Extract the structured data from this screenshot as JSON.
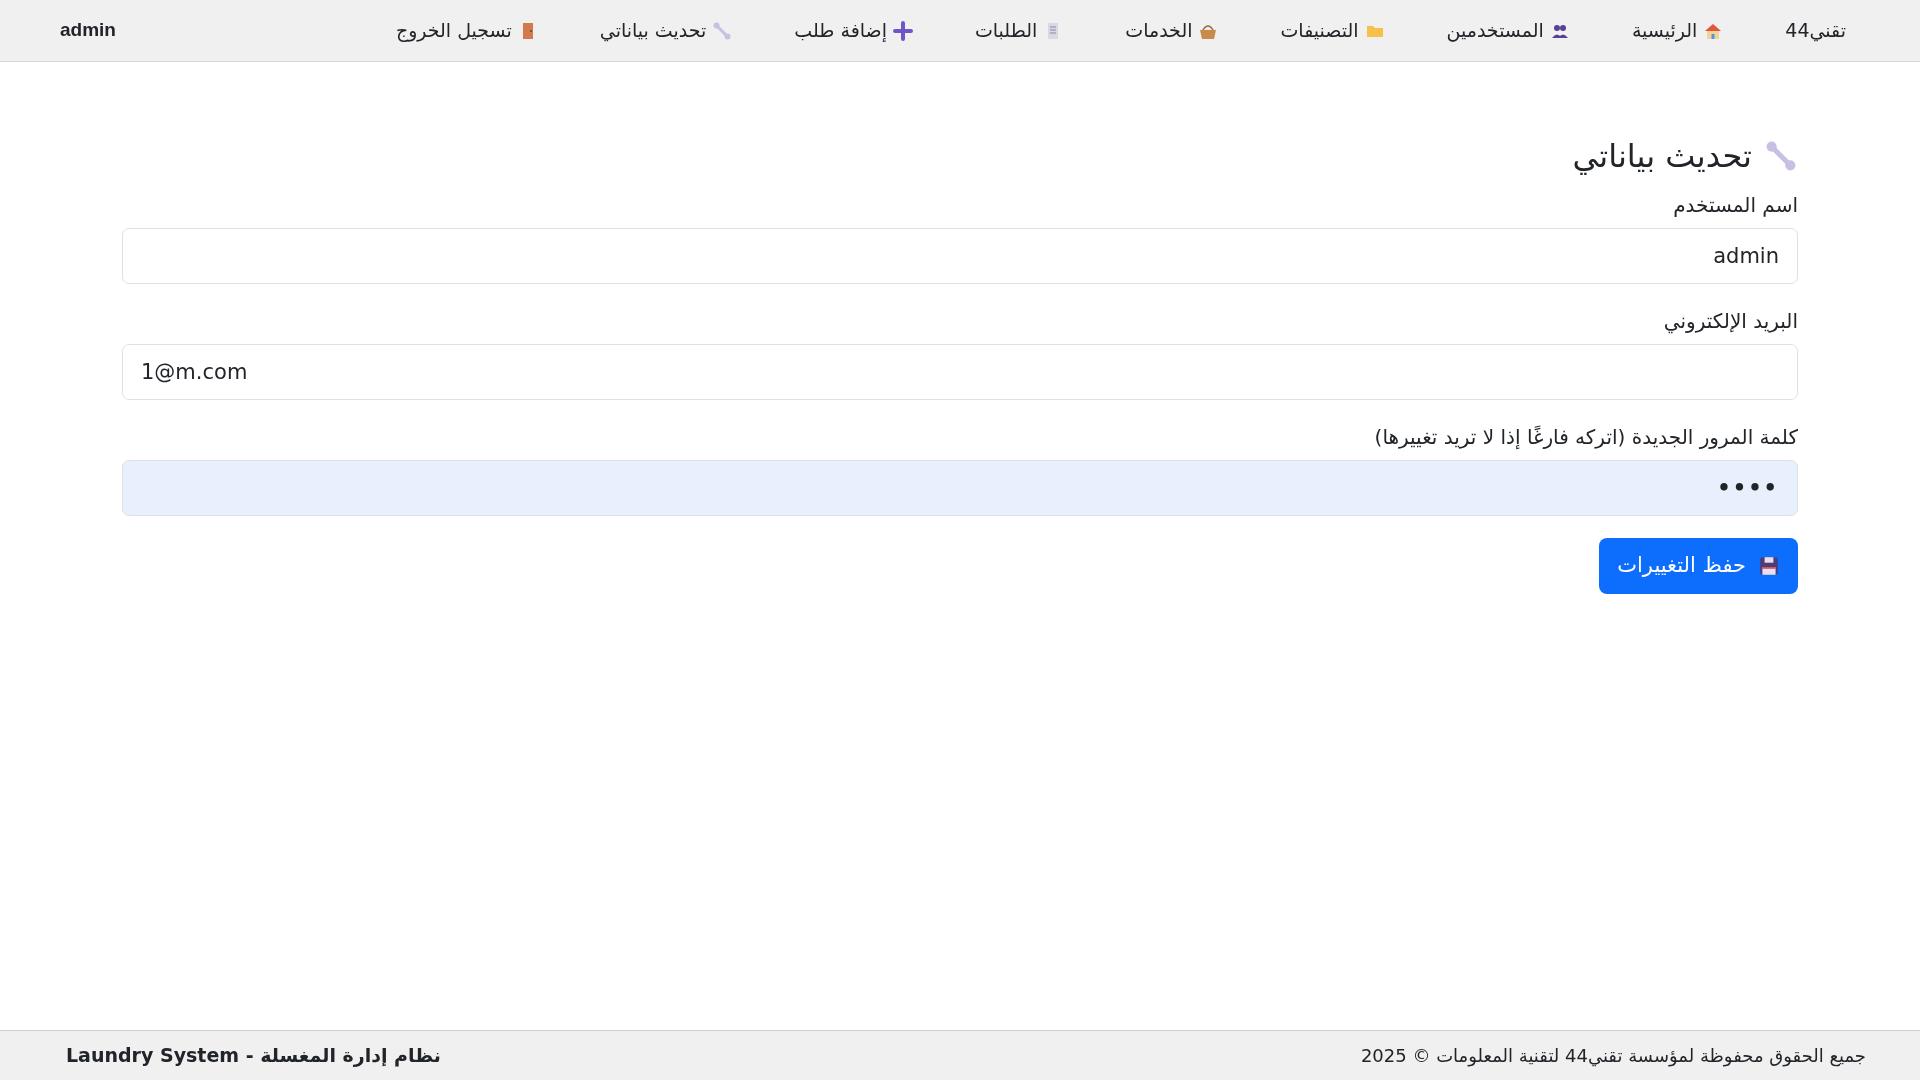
{
  "navbar": {
    "brand": "تقني44",
    "items": [
      {
        "label": "الرئيسية"
      },
      {
        "label": "المستخدمين"
      },
      {
        "label": "التصنيفات"
      },
      {
        "label": "الخدمات"
      },
      {
        "label": "الطلبات"
      },
      {
        "label": "إضافة طلب"
      },
      {
        "label": "تحديث بياناتي"
      },
      {
        "label": "تسجيل الخروج"
      }
    ],
    "user": "admin"
  },
  "page": {
    "title": "تحديث بياناتي",
    "fields": [
      {
        "label": "اسم المستخدم",
        "value": "admin",
        "kind": "text"
      },
      {
        "label": "البريد الإلكتروني",
        "value": "1@m.com",
        "kind": "email"
      },
      {
        "label": "كلمة المرور الجديدة (اتركه فارغًا إذا لا تريد تغييرها)",
        "value": "••••",
        "kind": "password"
      }
    ],
    "save_button": {
      "label": "حفظ التغييرات"
    }
  },
  "footer": {
    "copyright": "جميع الحقوق محفوظة لمؤسسة تقني44 لتقنية المعلومات © 2025",
    "system": "نظام إدارة المغسلة - Laundry System"
  }
}
